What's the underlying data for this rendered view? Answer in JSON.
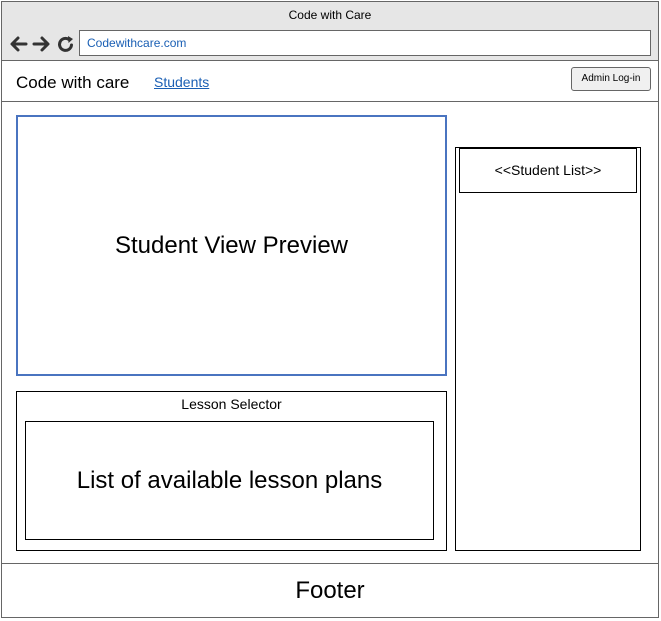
{
  "window": {
    "title": "Code with Care"
  },
  "browser": {
    "url": "Codewithcare.com",
    "icons": [
      "back-arrow-icon",
      "forward-arrow-icon",
      "refresh-icon"
    ]
  },
  "header": {
    "brand": "Code with care",
    "nav_link": "Students",
    "admin_button": "Admin Log-in"
  },
  "main": {
    "preview_label": "Student View Preview",
    "lesson_selector": {
      "title": "Lesson Selector",
      "list_label": "List of available lesson plans"
    },
    "student_list_label": "<<Student List>>"
  },
  "footer": {
    "label": "Footer"
  },
  "colors": {
    "accent_link": "#1a5fb4",
    "preview_border": "#4a74c0",
    "chrome_bg": "#e6e6e6"
  }
}
